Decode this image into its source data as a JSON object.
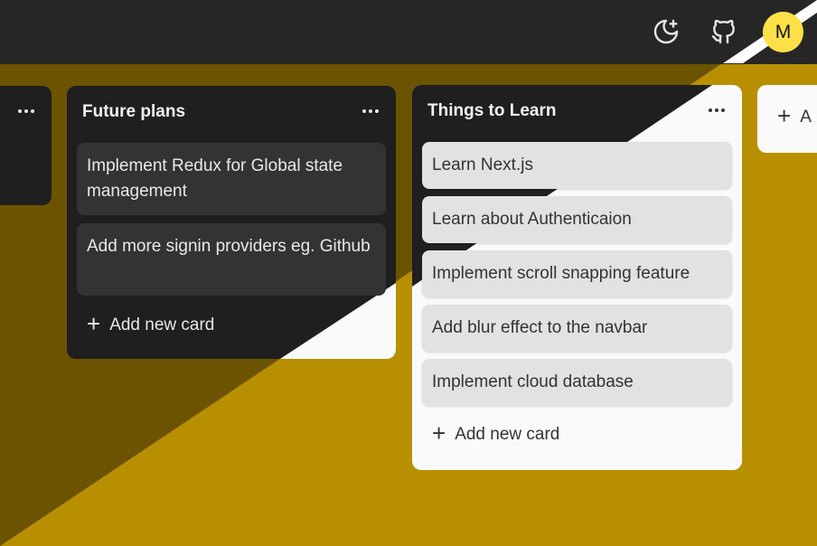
{
  "navbar": {
    "theme_icon": "moon-plus-icon",
    "github_icon": "github-icon",
    "avatar_initial": "M"
  },
  "columns": [
    {
      "title": "Future plans",
      "menu_icon": "ellipsis-icon",
      "cards": [
        "Implement Redux for Global state management",
        "Add more signin providers eg. Github"
      ],
      "add_label": "Add new card"
    },
    {
      "title": "Things to Learn",
      "menu_icon": "ellipsis-icon",
      "cards": [
        "Learn Next.js",
        "Learn about Authenticaion",
        "Implement scroll snapping feature",
        "Add blur effect to the navbar",
        "Implement cloud database"
      ],
      "add_label": "Add new card"
    }
  ],
  "add_list": {
    "label": "A"
  },
  "colors": {
    "board": "#b98f02",
    "navbar": "#262626",
    "column_dark": "#1f1f1f",
    "column_light": "#fafafa",
    "card_dark": "#333333",
    "card_light": "#e2e2e2",
    "avatar": "#fde047"
  }
}
